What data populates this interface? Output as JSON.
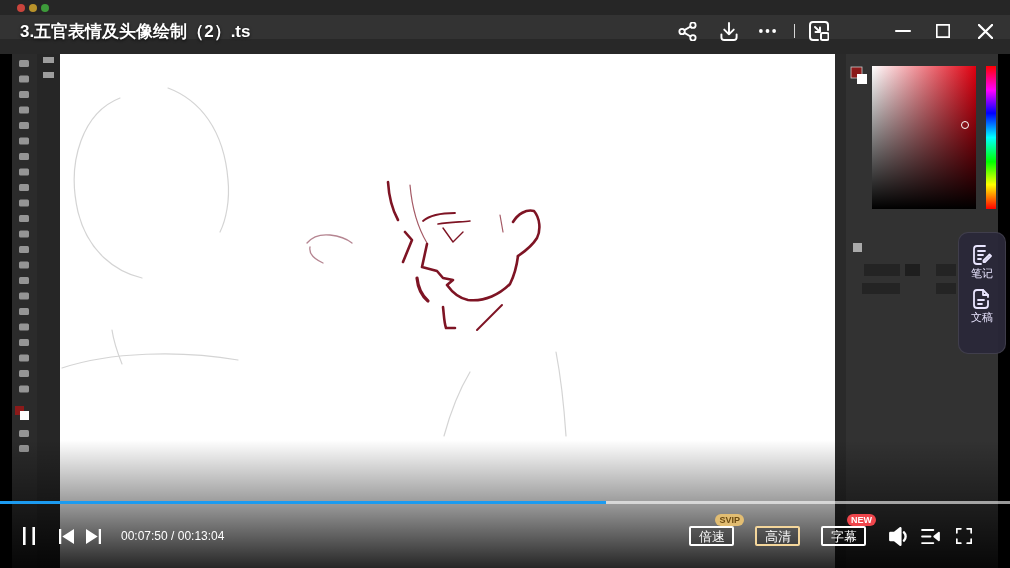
{
  "title": "3.五官表情及头像绘制（2）.ts",
  "side_panel": [
    {
      "kind": "notes",
      "label": "笔记"
    },
    {
      "kind": "transcript",
      "label": "文稿"
    }
  ],
  "player": {
    "playing": true,
    "progress": {
      "level": 0.6
    },
    "time": "00:07:50 / 00:13:04",
    "buttons": [
      {
        "label": "倍速",
        "highlighted": false,
        "badge": {
          "kind": "svip",
          "text": "SVIP"
        }
      },
      {
        "label": "高清",
        "highlighted": true
      },
      {
        "label": "字幕",
        "highlighted": false,
        "badge": {
          "kind": "new",
          "text": "NEW"
        }
      }
    ]
  }
}
